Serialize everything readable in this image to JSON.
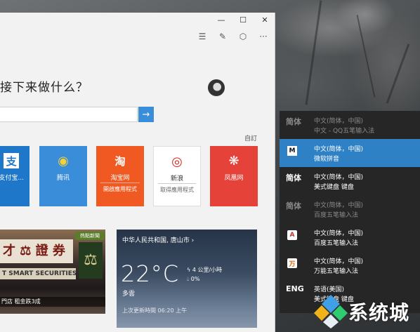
{
  "window": {
    "controls": {
      "minimize": "—",
      "maximize": "☐",
      "close": "✕"
    },
    "toolbar": {
      "hub": "☰",
      "note": "✎",
      "share": "⬡",
      "more": "···"
    }
  },
  "newtab": {
    "headline": "接下来做什么？",
    "search_placeholder": "",
    "search_go": "→",
    "customize": "自訂",
    "tiles": [
      {
        "label": "支付宝...",
        "icon": "支",
        "sub": ""
      },
      {
        "label": "腾讯",
        "icon": "◉",
        "sub": ""
      },
      {
        "label": "淘宝网",
        "icon": "淘",
        "sub": "開啟應用程式"
      },
      {
        "label": "新浪",
        "icon": "◎",
        "sub": "取得應用程式"
      },
      {
        "label": "凤凰网",
        "icon": "❋",
        "sub": ""
      }
    ],
    "news": {
      "sign": "才 ⚖ 證 券",
      "sign_en": "T SMART SECURITIES",
      "badge": "热點新聞",
      "scale": "⚖",
      "caption": "門店  租金跌3成"
    },
    "weather": {
      "location": "中华人民共和国, 唐山市 ›",
      "temperature": "22°C",
      "condition": "多雲",
      "wind": "4 公里/小時",
      "rain": "0%",
      "updated": "上次更新時間 06:20 上午"
    }
  },
  "ime": {
    "items": [
      {
        "badge": "简体",
        "lang": "中文(简体，中国)",
        "name": "中文 - QQ五笔输入法",
        "selected": false,
        "dim": true
      },
      {
        "badge": "M",
        "lang": "中文(简体，中国)",
        "name": "微软拼音",
        "selected": true,
        "dim": false
      },
      {
        "badge": "简体",
        "lang": "中文(简体，中国)",
        "name": "美式键盘 键盘",
        "selected": false,
        "dim": false
      },
      {
        "badge": "简体",
        "lang": "中文(简体，中国)",
        "name": "百度五笔输入法",
        "selected": false,
        "dim": true
      },
      {
        "badge": "A",
        "lang": "中文(简体，中国)",
        "name": "百度五笔输入法",
        "selected": false,
        "dim": false
      },
      {
        "badge": "万",
        "lang": "中文(简体，中国)",
        "name": "万能五笔输入法",
        "selected": false,
        "dim": false
      },
      {
        "badge": "ENG",
        "lang": "英语(美国)",
        "name": "美式键盘 键盘",
        "selected": false,
        "dim": false
      }
    ]
  },
  "watermark": {
    "text": "系统城"
  },
  "colors": {
    "accent": "#2f81c5",
    "flyout": "#262626"
  }
}
